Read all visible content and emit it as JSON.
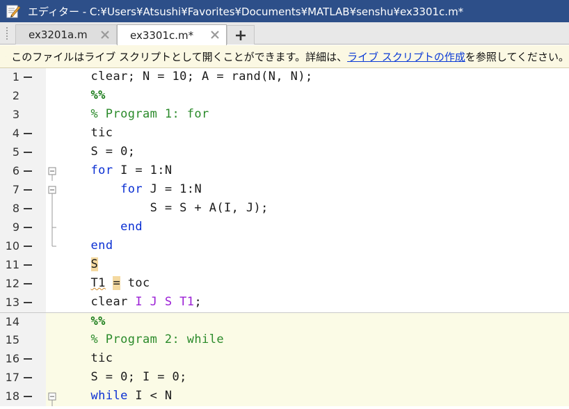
{
  "window": {
    "title": "エディター - C:¥Users¥Atsushi¥Favorites¥Documents¥MATLAB¥senshu¥ex3301c.m*"
  },
  "tabs": [
    {
      "label": "ex3201a.m",
      "active": false
    },
    {
      "label": "ex3301c.m*",
      "active": true
    }
  ],
  "infobar": {
    "text_before": "このファイルはライブ スクリプトとして開くことができます。詳細は、",
    "link": "ライブ スクリプトの作成",
    "text_after": " を参照してください。"
  },
  "lines": [
    {
      "num": "1",
      "dash": true,
      "parts": [
        {
          "t": "    clear; N = 10; A = rand(N, N);",
          "c": ""
        }
      ]
    },
    {
      "num": "2",
      "dash": false,
      "cell": "start",
      "parts": [
        {
          "t": "    ",
          "c": ""
        },
        {
          "t": "%%",
          "c": "cellmark"
        }
      ]
    },
    {
      "num": "3",
      "dash": false,
      "parts": [
        {
          "t": "    % Program 1: for",
          "c": "cm"
        }
      ]
    },
    {
      "num": "4",
      "dash": true,
      "parts": [
        {
          "t": "    tic",
          "c": ""
        }
      ]
    },
    {
      "num": "5",
      "dash": true,
      "parts": [
        {
          "t": "    S = 0;",
          "c": ""
        }
      ]
    },
    {
      "num": "6",
      "dash": true,
      "fold": "box",
      "parts": [
        {
          "t": "    ",
          "c": ""
        },
        {
          "t": "for",
          "c": "kw"
        },
        {
          "t": " I = 1:N",
          "c": ""
        }
      ]
    },
    {
      "num": "7",
      "dash": true,
      "fold": "box",
      "parts": [
        {
          "t": "        ",
          "c": ""
        },
        {
          "t": "for",
          "c": "kw"
        },
        {
          "t": " J = 1:N",
          "c": ""
        }
      ]
    },
    {
      "num": "8",
      "dash": true,
      "fold": "line",
      "parts": [
        {
          "t": "            S = S + A(I, J);",
          "c": ""
        }
      ]
    },
    {
      "num": "9",
      "dash": true,
      "fold": "tick",
      "parts": [
        {
          "t": "        ",
          "c": ""
        },
        {
          "t": "end",
          "c": "kw"
        }
      ]
    },
    {
      "num": "10",
      "dash": true,
      "fold": "end",
      "parts": [
        {
          "t": "    ",
          "c": ""
        },
        {
          "t": "end",
          "c": "kw"
        }
      ]
    },
    {
      "num": "11",
      "dash": true,
      "parts": [
        {
          "t": "    ",
          "c": ""
        },
        {
          "t": "S",
          "c": "hl"
        }
      ]
    },
    {
      "num": "12",
      "dash": true,
      "parts": [
        {
          "t": "    ",
          "c": ""
        },
        {
          "t": "T1",
          "c": "squig"
        },
        {
          "t": " ",
          "c": ""
        },
        {
          "t": "=",
          "c": "hl"
        },
        {
          "t": " toc",
          "c": ""
        }
      ]
    },
    {
      "num": "13",
      "dash": true,
      "parts": [
        {
          "t": "    clear ",
          "c": ""
        },
        {
          "t": "I J S T1",
          "c": "var"
        },
        {
          "t": ";",
          "c": ""
        }
      ]
    },
    {
      "num": "14",
      "dash": false,
      "cell": "first",
      "parts": [
        {
          "t": "    ",
          "c": ""
        },
        {
          "t": "%%",
          "c": "cellmark"
        }
      ]
    },
    {
      "num": "15",
      "dash": false,
      "cell": "in",
      "parts": [
        {
          "t": "    % Program 2: while",
          "c": "cm"
        }
      ]
    },
    {
      "num": "16",
      "dash": true,
      "cell": "in",
      "parts": [
        {
          "t": "    tic",
          "c": ""
        }
      ]
    },
    {
      "num": "17",
      "dash": true,
      "cell": "in",
      "parts": [
        {
          "t": "    S = 0; I = 0;",
          "c": ""
        }
      ]
    },
    {
      "num": "18",
      "dash": true,
      "cell": "in",
      "fold": "box",
      "parts": [
        {
          "t": "    ",
          "c": ""
        },
        {
          "t": "while",
          "c": "kw"
        },
        {
          "t": " I < N",
          "c": ""
        }
      ]
    }
  ]
}
